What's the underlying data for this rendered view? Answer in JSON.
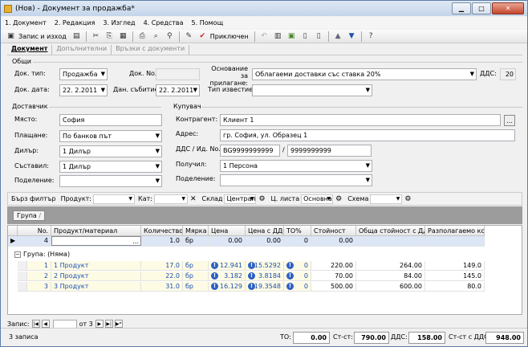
{
  "window": {
    "title": "(Нов) - Документ за продажба*",
    "controls": [
      "minimize-icon",
      "maximize-icon",
      "close-icon"
    ]
  },
  "menu": [
    "1. Документ",
    "2. Редакция",
    "3. Изглед",
    "4. Средства",
    "5. Помощ"
  ],
  "toolbar": {
    "save_close": "Запис и изход",
    "accept": "Приключен"
  },
  "tabs": [
    "Документ",
    "Допълнителни",
    "Връзки с документи"
  ],
  "general": {
    "section": "Общи",
    "doc_type_label": "Док. тип:",
    "doc_type": "Продажба",
    "doc_no_label": "Док. No.",
    "doc_no": "",
    "basis_label": "Основание за прилагане:",
    "basis": "Облагаеми доставки със ставка 20%",
    "vat_label": "ДДС:",
    "vat": "20",
    "doc_date_label": "Док. дата:",
    "doc_date": "22. 2.2011",
    "tax_date_label": "Дан. събитие:",
    "tax_date": "22. 2.2011",
    "notice_label": "Тип известие:",
    "notice": ""
  },
  "supplier": {
    "section": "Доставчик",
    "place_label": "Място:",
    "place": "София",
    "payment_label": "Плащане:",
    "payment": "По банков път",
    "dealer_label": "Дилър:",
    "dealer": "1 Дилър",
    "creator_label": "Съставил:",
    "creator": "1 Дилър",
    "division_label": "Поделение:",
    "division": ""
  },
  "buyer": {
    "section": "Купувач",
    "contractor_label": "Контрагент:",
    "contractor": "Клиент 1",
    "address_label": "Адрес:",
    "address": "гр. София, ул. Образец 1",
    "vat_id_label": "ДДС / Ид. No.",
    "vat_no": "BG9999999999",
    "id_no": "9999999999",
    "received_label": "Получил:",
    "received": "1 Персона",
    "division_label": "Поделение:",
    "division": ""
  },
  "filter": {
    "quick_filter": "Бърз филтър",
    "product_label": "Продукт:",
    "category_label": "Кат:",
    "warehouse_label": "Склад",
    "warehouse": "Централ",
    "pricelist_label": "Ц. листа",
    "pricelist": "Основна",
    "scheme_label": "Схема"
  },
  "group_chip": "Група",
  "grid": {
    "columns": [
      "No.",
      "Продукт/материал",
      "Количество",
      "Мярка",
      "Цена",
      "Цена с ДДС",
      "ТО%",
      "Стойност",
      "Обща стойност с ДДС",
      "Разполагаемо кол."
    ],
    "edit_row": [
      "4",
      "",
      "1.0",
      "бр",
      "0.00",
      "0.00",
      "0",
      "0.00",
      "",
      ""
    ],
    "group_label": "Група: (Няма)",
    "rows": [
      [
        "1",
        "1 Продукт",
        "17.0",
        "бр",
        "12.941",
        "15.5292",
        "0",
        "220.00",
        "264.00",
        "149.0"
      ],
      [
        "2",
        "2 Продукт",
        "22.0",
        "бр",
        "3.182",
        "3.8184",
        "0",
        "70.00",
        "84.00",
        "145.0"
      ],
      [
        "3",
        "3 Продукт",
        "31.0",
        "бр",
        "16.129",
        "19.3548",
        "0",
        "500.00",
        "600.00",
        "80.0"
      ]
    ]
  },
  "nav": {
    "record_label": "Запис:",
    "of_label": "от 3"
  },
  "status": {
    "count": "3 записа",
    "to_label": "ТО:",
    "to": "0.00",
    "cost_label": "Ст-ст:",
    "cost": "790.00",
    "vat_label": "ДДС:",
    "vat": "158.00",
    "total_label": "Ст-ст с ДДС:",
    "total": "948.00"
  }
}
